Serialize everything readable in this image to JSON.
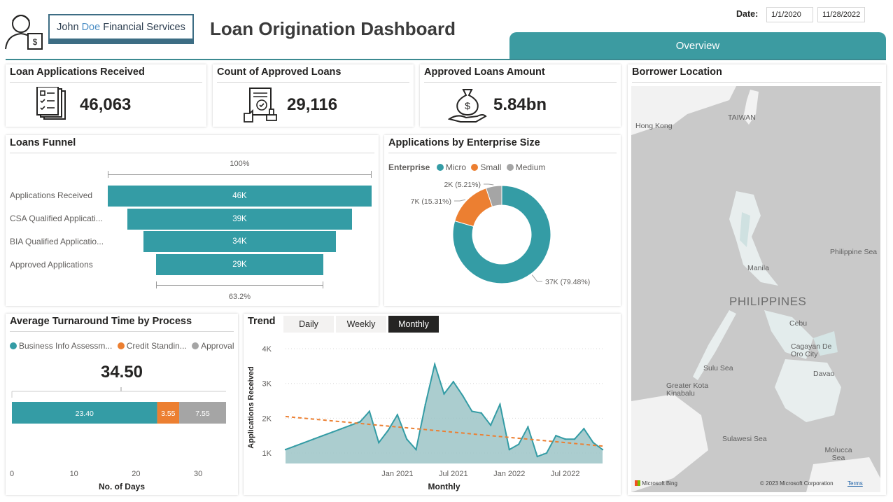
{
  "header": {
    "brand_first": "John",
    "brand_middle": "Doe",
    "brand_rest": "Financial Services",
    "title": "Loan Origination Dashboard",
    "date_label": "Date:",
    "date_start": "1/1/2020",
    "date_end": "11/28/2022",
    "tab_overview": "Overview"
  },
  "kpis": [
    {
      "title": "Loan Applications Received",
      "value": "46,063",
      "icon": "document-list-icon"
    },
    {
      "title": "Count of Approved Loans",
      "value": "29,116",
      "icon": "approved-contract-icon"
    },
    {
      "title": "Approved Loans Amount",
      "value": "5.84bn",
      "icon": "money-bag-hand-icon"
    }
  ],
  "funnel": {
    "title": "Loans Funnel",
    "top_pct": "100%",
    "bottom_pct": "63.2%",
    "stages": [
      {
        "label": "Applications Received",
        "value_label": "46K",
        "value": 46063
      },
      {
        "label": "CSA Qualified Applicati...",
        "value_label": "39K",
        "value": 39000
      },
      {
        "label": "BIA Qualified Applicatio...",
        "value_label": "34K",
        "value": 34000
      },
      {
        "label": "Approved Applications",
        "value_label": "29K",
        "value": 29116
      }
    ]
  },
  "enterprise": {
    "title": "Applications by Enterprise Size",
    "legend_title": "Enterprise",
    "slices": [
      {
        "name": "Micro",
        "label": "37K (79.48%)",
        "pct": 79.48,
        "color": "#349ca5"
      },
      {
        "name": "Small",
        "label": "7K (15.31%)",
        "pct": 15.31,
        "color": "#ec7f31"
      },
      {
        "name": "Medium",
        "label": "2K (5.21%)",
        "pct": 5.21,
        "color": "#a5a5a5"
      }
    ]
  },
  "turnaround": {
    "title": "Average Turnaround Time by Process",
    "legend": [
      {
        "name": "Business Info Assessm...",
        "color": "#349ca5"
      },
      {
        "name": "Credit Standin...",
        "color": "#ec7f31"
      },
      {
        "name": "Approval",
        "color": "#a5a5a5"
      }
    ],
    "total": "34.50",
    "segments": [
      {
        "value": 23.4,
        "label": "23.40",
        "color": "#349ca5"
      },
      {
        "value": 3.55,
        "label": "3.55",
        "color": "#ec7f31"
      },
      {
        "value": 7.55,
        "label": "7.55",
        "color": "#a5a5a5"
      }
    ],
    "axis_max": 34.5,
    "ticks": [
      "0",
      "10",
      "20",
      "30"
    ],
    "xlabel": "No. of Days"
  },
  "trend": {
    "title": "Trend",
    "tabs": [
      {
        "label": "Daily",
        "active": false
      },
      {
        "label": "Weekly",
        "active": false
      },
      {
        "label": "Monthly",
        "active": true
      }
    ],
    "xlabel": "Monthly",
    "ylabel": "Applications Received"
  },
  "map": {
    "title": "Borrower Location",
    "labels": {
      "taiwan": "TAIWAN",
      "hongkong": "Hong Kong",
      "philsea": "Philippine Sea",
      "manila": "Manila",
      "philippines": "PHILIPPINES",
      "cebu": "Cebu",
      "cdo": "Cagayan De Oro City",
      "sulu": "Sulu Sea",
      "davao": "Davao",
      "kota": "Greater Kota Kinabalu",
      "sulawesi": "Sulawesi Sea",
      "molucca": "Molucca Sea",
      "bing": "Microsoft Bing",
      "copyright": "© 2023 Microsoft Corporation",
      "terms": "Terms"
    }
  },
  "chart_data": {
    "type": "area",
    "xlabel": "Monthly",
    "ylabel": "Applications Received",
    "x": [
      "2020-01",
      "2020-02",
      "2020-03",
      "2020-04",
      "2020-05",
      "2020-06",
      "2020-07",
      "2020-08",
      "2020-09",
      "2020-10",
      "2020-11",
      "2020-12",
      "2021-01",
      "2021-02",
      "2021-03",
      "2021-04",
      "2021-05",
      "2021-06",
      "2021-07",
      "2021-08",
      "2021-09",
      "2021-10",
      "2021-11",
      "2021-12",
      "2022-01",
      "2022-02",
      "2022-03",
      "2022-04",
      "2022-05",
      "2022-06",
      "2022-07",
      "2022-08",
      "2022-09",
      "2022-10",
      "2022-11"
    ],
    "series": [
      {
        "values": [
          1100,
          1200,
          1300,
          1400,
          1500,
          1600,
          1700,
          1800,
          1900,
          2200,
          1300,
          1650,
          2100,
          1400,
          1100,
          2400,
          3550,
          2700,
          3050,
          2650,
          2200,
          2150,
          1800,
          2400,
          1100,
          1250,
          1750,
          900,
          1000,
          1500,
          1400,
          1400,
          1700,
          1300,
          1100
        ]
      }
    ],
    "trendline": {
      "start": 2050,
      "end": 1200
    },
    "xtick_labels": [
      "Jan 2021",
      "Jul 2021",
      "Jan 2022",
      "Jul 2022"
    ],
    "ytick_labels": [
      "1K",
      "2K",
      "3K",
      "4K"
    ],
    "ylim": [
      700,
      4000
    ],
    "grid": true,
    "colors": {
      "area": "#9cc4c7",
      "line": "#349ca5",
      "trend": "#ec7f31"
    }
  }
}
